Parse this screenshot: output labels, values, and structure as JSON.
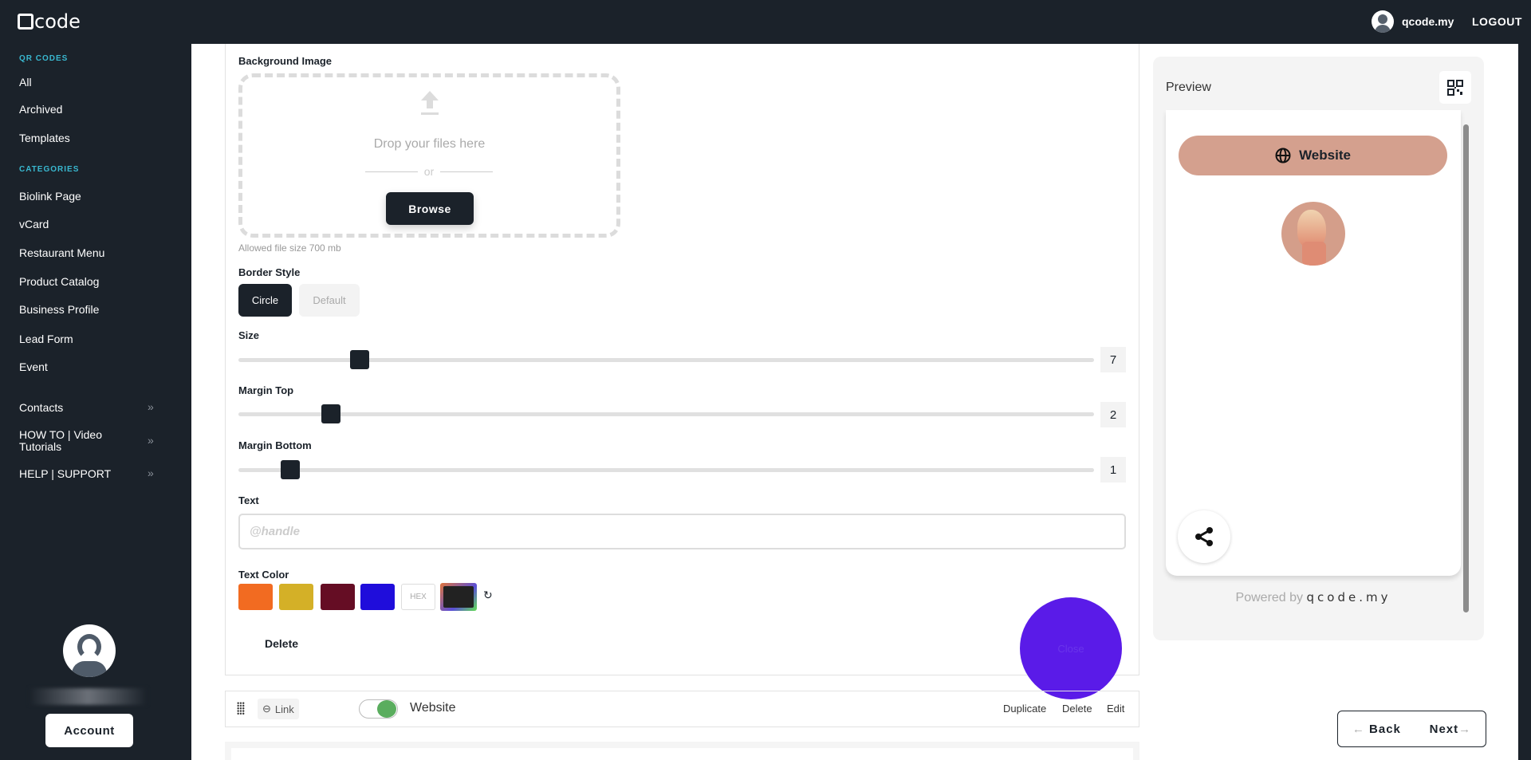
{
  "header": {
    "logo_text": "code",
    "username": "qcode.my",
    "logout_label": "LOGOUT"
  },
  "sidebar": {
    "section_qr": "QR CODES",
    "qr_items": [
      "All",
      "Archived",
      "Templates"
    ],
    "section_categories": "CATEGORIES",
    "category_items": [
      "Biolink Page",
      "vCard",
      "Restaurant Menu",
      "Product Catalog",
      "Business Profile",
      "Lead Form",
      "Event"
    ],
    "expand_items": [
      "Contacts",
      "HOW TO | Video Tutorials",
      "HELP | SUPPORT"
    ],
    "expand_chevron": "»",
    "account_label": "Account"
  },
  "form": {
    "background_image_label": "Background Image",
    "drop_text": "Drop your files here",
    "or_text": "or",
    "browse_label": "Browse",
    "allowed_size": "Allowed file size  700 mb",
    "border_style_label": "Border Style",
    "border_options": [
      "Circle",
      "Default"
    ],
    "border_selected": "Circle",
    "size_label": "Size",
    "size_value": "7",
    "margin_top_label": "Margin Top",
    "margin_top_value": "2",
    "margin_bottom_label": "Margin Bottom",
    "margin_bottom_value": "1",
    "slider_max": 50,
    "text_label": "Text",
    "text_placeholder": "@handle",
    "text_color_label": "Text Color",
    "swatches": [
      "#f26b21",
      "#d4b027",
      "#650d24",
      "#1f0ddb"
    ],
    "hex_label": "HEX",
    "selected_color": "#222222",
    "delete_label": "Delete",
    "close_label": "Close"
  },
  "link_row": {
    "type_label": "Link",
    "enabled": true,
    "name": "Website",
    "actions": [
      "Duplicate",
      "Delete",
      "Edit"
    ]
  },
  "preview": {
    "title": "Preview",
    "website_button": "Website",
    "button_color": "#d4a08e",
    "powered_by": "Powered by",
    "brand": "qcode.my"
  },
  "nav": {
    "back_label": "Back",
    "next_label": "Next"
  }
}
